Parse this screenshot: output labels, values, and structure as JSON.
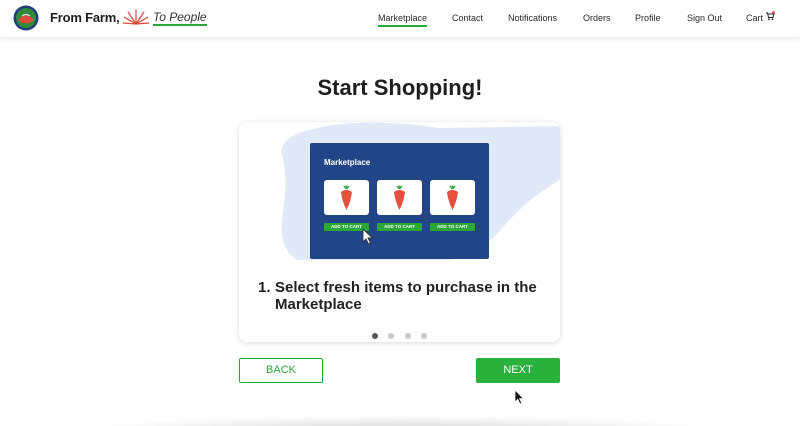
{
  "brand": {
    "name": "From Farm,",
    "tagline": "To People",
    "logo_icon": "farm-globe-icon",
    "accent": "#2ca83a"
  },
  "nav": {
    "items": [
      "Marketplace",
      "Contact",
      "Notifications",
      "Orders",
      "Profile",
      "Sign Out",
      "Cart"
    ],
    "active": "Marketplace",
    "cart_icon": "shopping-cart-icon"
  },
  "page": {
    "title": "Start Shopping!"
  },
  "card": {
    "illustration": {
      "title": "Marketplace",
      "tiles": [
        {
          "icon": "carrot-icon",
          "button": "ADD TO CART"
        },
        {
          "icon": "carrot-icon",
          "button": "ADD TO CART"
        },
        {
          "icon": "carrot-icon",
          "button": "ADD TO CART"
        }
      ],
      "panel_color": "#214586"
    },
    "step_number": "1.",
    "step_text": "Select fresh items to purchase in the Marketplace",
    "dots_total": 4,
    "dots_active": 1
  },
  "actions": {
    "back_label": "BACK",
    "next_label": "NEXT"
  }
}
